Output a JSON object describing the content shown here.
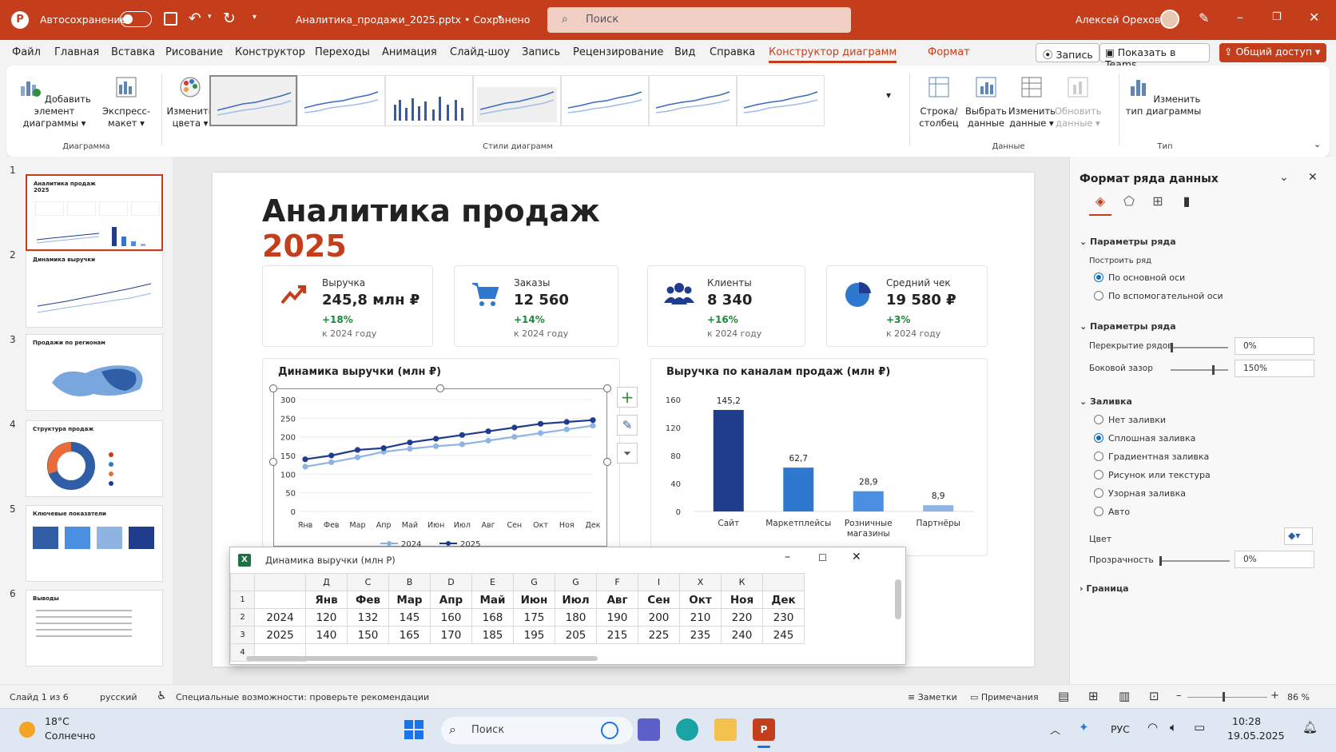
{
  "titlebar": {
    "autosave": "Автосохранение",
    "doc": "Аналитика_продажи_2025.pptx • Сохранено",
    "search": "Поиск",
    "user": "Алексей Орехов"
  },
  "menu": [
    "Файл",
    "Главная",
    "Вставка",
    "Рисование",
    "Конструктор",
    "Переходы",
    "Анимация",
    "Слайд-шоу",
    "Запись",
    "Рецензирование",
    "Вид",
    "Справка",
    "Конструктор диаграмм",
    "Формат"
  ],
  "menu_right": {
    "record": "Запись",
    "teams": "Показать в Teams",
    "share": "Общий доступ"
  },
  "ribbon": {
    "add_element": "Добавить элемент диаграммы",
    "express": "Экспресс-макет",
    "colors": "Изменить цвета",
    "group_layouts": "Диаграмма",
    "group_styles": "Стили диаграмм",
    "rowcol": "Строка/столбец",
    "select_data": "Выбрать данные",
    "edit_data": "Изменить данные",
    "refresh": "Обновить данные",
    "group_data": "Данные",
    "change_type": "Изменить тип диаграммы",
    "group_type": "Тип"
  },
  "slides": [
    {
      "n": "1",
      "t": "Аналитика продаж 2025"
    },
    {
      "n": "2",
      "t": "Динамика выручки"
    },
    {
      "n": "3",
      "t": "Продажи по регионам"
    },
    {
      "n": "4",
      "t": "Структура продаж"
    },
    {
      "n": "5",
      "t": "Ключевые показатели"
    },
    {
      "n": "6",
      "t": "Выводы"
    }
  ],
  "slide": {
    "title": "Аналитика продаж",
    "year": "2025",
    "kpis": [
      {
        "label": "Выручка",
        "value": "245,8 млн ₽",
        "change": "+18%",
        "sub": "к 2024 году"
      },
      {
        "label": "Заказы",
        "value": "12 560",
        "change": "+14%",
        "sub": "к 2024 году"
      },
      {
        "label": "Клиенты",
        "value": "8 340",
        "change": "+16%",
        "sub": "к 2024 году"
      },
      {
        "label": "Средний чек",
        "value": "19 580 ₽",
        "change": "+3%",
        "sub": "к 2024 году"
      }
    ]
  },
  "chart_data": [
    {
      "type": "line",
      "title": "Динамика выручки (млн ₽)",
      "categories": [
        "Янв",
        "Фев",
        "Мар",
        "Апр",
        "Май",
        "Июн",
        "Июл",
        "Авг",
        "Сен",
        "Окт",
        "Ноя",
        "Дек"
      ],
      "series": [
        {
          "name": "2024",
          "values": [
            120,
            132,
            145,
            160,
            168,
            175,
            180,
            190,
            200,
            210,
            220,
            230
          ],
          "color": "#8fb4e3"
        },
        {
          "name": "2025",
          "values": [
            140,
            150,
            165,
            170,
            185,
            195,
            205,
            215,
            225,
            235,
            240,
            245
          ],
          "color": "#1f3d8c"
        }
      ],
      "ylim": [
        0,
        300
      ],
      "yticks": [
        0,
        50,
        100,
        150,
        200,
        250,
        300
      ],
      "legend": "bottom"
    },
    {
      "type": "bar",
      "title": "Выручка по каналам продаж (млн ₽)",
      "categories": [
        "Сайт",
        "Маркетплейсы",
        "Розничные магазины",
        "Партнёры"
      ],
      "values": [
        145.2,
        62.7,
        28.9,
        8.9
      ],
      "labels": [
        "145,2",
        "62,7",
        "28,9",
        "8,9"
      ],
      "colors": [
        "#1f3d8c",
        "#2f78d0",
        "#4b8fe0",
        "#8fb4e3"
      ],
      "ylim": [
        0,
        160
      ],
      "yticks": [
        0,
        40,
        80,
        120,
        160
      ]
    }
  ],
  "datawin": {
    "title": "Динамика выручки (млн Р)",
    "cols": [
      "Д",
      "С",
      "В",
      "D",
      "Е",
      "G",
      "G",
      "F",
      "I",
      "Х",
      "К"
    ],
    "header": [
      "Янв",
      "Фев",
      "Мар",
      "Апр",
      "Май",
      "Июн",
      "Июл",
      "Авг",
      "Сен",
      "Окт",
      "Ноя",
      "Дек"
    ],
    "rows": [
      {
        "label": "2024",
        "values": [
          "120",
          "132",
          "145",
          "160",
          "168",
          "175",
          "180",
          "190",
          "200",
          "210",
          "220",
          "230"
        ]
      },
      {
        "label": "2025",
        "values": [
          "140",
          "150",
          "165",
          "170",
          "185",
          "195",
          "205",
          "215",
          "225",
          "235",
          "240",
          "245"
        ]
      }
    ]
  },
  "format": {
    "title": "Формат ряда данных",
    "sec1": "Параметры ряда",
    "build": "Построить ряд",
    "primary": "По основной оси",
    "secondary": "По вспомогательной оси",
    "sec2": "Параметры ряда",
    "overlap": "Перекрытие рядов",
    "overlap_val": "0%",
    "gap": "Боковой зазор",
    "gap_val": "150%",
    "fill": "Заливка",
    "fills": [
      "Нет заливки",
      "Сплошная заливка",
      "Градиентная заливка",
      "Рисунок или текстура",
      "Узорная заливка",
      "Авто"
    ],
    "color": "Цвет",
    "transp": "Прозрачность",
    "transp_val": "0%",
    "border": "Граница"
  },
  "status": {
    "slide": "Слайд 1 из 6",
    "lang": "русский",
    "access": "Специальные возможности: проверьте рекомендации",
    "notes": "Заметки",
    "comments": "Примечания",
    "zoom": "86 %"
  },
  "taskbar": {
    "temp": "18°C",
    "weather": "Солнечно",
    "search": "Поиск",
    "lang": "РУС",
    "time": "10:28",
    "date": "19.05.2025"
  }
}
